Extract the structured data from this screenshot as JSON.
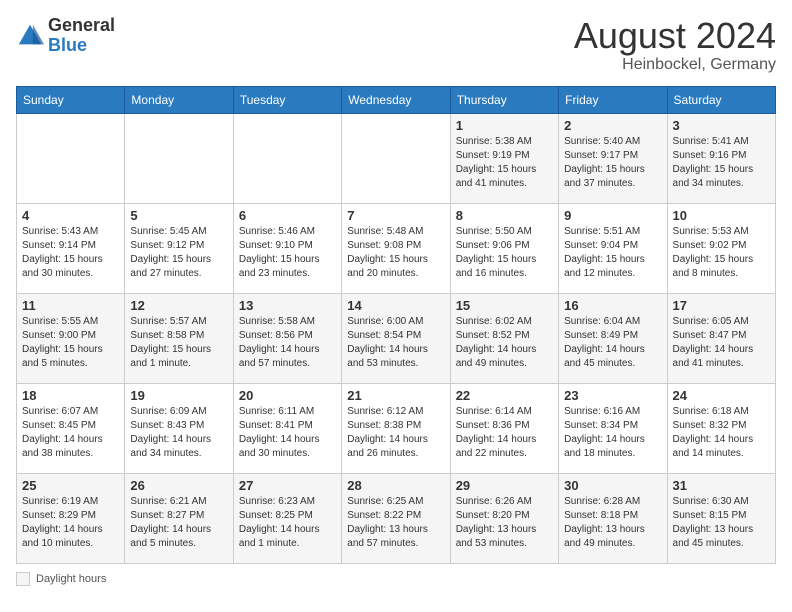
{
  "header": {
    "logo_general": "General",
    "logo_blue": "Blue",
    "month": "August 2024",
    "location": "Heinbockel, Germany"
  },
  "days_of_week": [
    "Sunday",
    "Monday",
    "Tuesday",
    "Wednesday",
    "Thursday",
    "Friday",
    "Saturday"
  ],
  "weeks": [
    [
      {
        "day": "",
        "info": ""
      },
      {
        "day": "",
        "info": ""
      },
      {
        "day": "",
        "info": ""
      },
      {
        "day": "",
        "info": ""
      },
      {
        "day": "1",
        "info": "Sunrise: 5:38 AM\nSunset: 9:19 PM\nDaylight: 15 hours\nand 41 minutes."
      },
      {
        "day": "2",
        "info": "Sunrise: 5:40 AM\nSunset: 9:17 PM\nDaylight: 15 hours\nand 37 minutes."
      },
      {
        "day": "3",
        "info": "Sunrise: 5:41 AM\nSunset: 9:16 PM\nDaylight: 15 hours\nand 34 minutes."
      }
    ],
    [
      {
        "day": "4",
        "info": "Sunrise: 5:43 AM\nSunset: 9:14 PM\nDaylight: 15 hours\nand 30 minutes."
      },
      {
        "day": "5",
        "info": "Sunrise: 5:45 AM\nSunset: 9:12 PM\nDaylight: 15 hours\nand 27 minutes."
      },
      {
        "day": "6",
        "info": "Sunrise: 5:46 AM\nSunset: 9:10 PM\nDaylight: 15 hours\nand 23 minutes."
      },
      {
        "day": "7",
        "info": "Sunrise: 5:48 AM\nSunset: 9:08 PM\nDaylight: 15 hours\nand 20 minutes."
      },
      {
        "day": "8",
        "info": "Sunrise: 5:50 AM\nSunset: 9:06 PM\nDaylight: 15 hours\nand 16 minutes."
      },
      {
        "day": "9",
        "info": "Sunrise: 5:51 AM\nSunset: 9:04 PM\nDaylight: 15 hours\nand 12 minutes."
      },
      {
        "day": "10",
        "info": "Sunrise: 5:53 AM\nSunset: 9:02 PM\nDaylight: 15 hours\nand 8 minutes."
      }
    ],
    [
      {
        "day": "11",
        "info": "Sunrise: 5:55 AM\nSunset: 9:00 PM\nDaylight: 15 hours\nand 5 minutes."
      },
      {
        "day": "12",
        "info": "Sunrise: 5:57 AM\nSunset: 8:58 PM\nDaylight: 15 hours\nand 1 minute."
      },
      {
        "day": "13",
        "info": "Sunrise: 5:58 AM\nSunset: 8:56 PM\nDaylight: 14 hours\nand 57 minutes."
      },
      {
        "day": "14",
        "info": "Sunrise: 6:00 AM\nSunset: 8:54 PM\nDaylight: 14 hours\nand 53 minutes."
      },
      {
        "day": "15",
        "info": "Sunrise: 6:02 AM\nSunset: 8:52 PM\nDaylight: 14 hours\nand 49 minutes."
      },
      {
        "day": "16",
        "info": "Sunrise: 6:04 AM\nSunset: 8:49 PM\nDaylight: 14 hours\nand 45 minutes."
      },
      {
        "day": "17",
        "info": "Sunrise: 6:05 AM\nSunset: 8:47 PM\nDaylight: 14 hours\nand 41 minutes."
      }
    ],
    [
      {
        "day": "18",
        "info": "Sunrise: 6:07 AM\nSunset: 8:45 PM\nDaylight: 14 hours\nand 38 minutes."
      },
      {
        "day": "19",
        "info": "Sunrise: 6:09 AM\nSunset: 8:43 PM\nDaylight: 14 hours\nand 34 minutes."
      },
      {
        "day": "20",
        "info": "Sunrise: 6:11 AM\nSunset: 8:41 PM\nDaylight: 14 hours\nand 30 minutes."
      },
      {
        "day": "21",
        "info": "Sunrise: 6:12 AM\nSunset: 8:38 PM\nDaylight: 14 hours\nand 26 minutes."
      },
      {
        "day": "22",
        "info": "Sunrise: 6:14 AM\nSunset: 8:36 PM\nDaylight: 14 hours\nand 22 minutes."
      },
      {
        "day": "23",
        "info": "Sunrise: 6:16 AM\nSunset: 8:34 PM\nDaylight: 14 hours\nand 18 minutes."
      },
      {
        "day": "24",
        "info": "Sunrise: 6:18 AM\nSunset: 8:32 PM\nDaylight: 14 hours\nand 14 minutes."
      }
    ],
    [
      {
        "day": "25",
        "info": "Sunrise: 6:19 AM\nSunset: 8:29 PM\nDaylight: 14 hours\nand 10 minutes."
      },
      {
        "day": "26",
        "info": "Sunrise: 6:21 AM\nSunset: 8:27 PM\nDaylight: 14 hours\nand 5 minutes."
      },
      {
        "day": "27",
        "info": "Sunrise: 6:23 AM\nSunset: 8:25 PM\nDaylight: 14 hours\nand 1 minute."
      },
      {
        "day": "28",
        "info": "Sunrise: 6:25 AM\nSunset: 8:22 PM\nDaylight: 13 hours\nand 57 minutes."
      },
      {
        "day": "29",
        "info": "Sunrise: 6:26 AM\nSunset: 8:20 PM\nDaylight: 13 hours\nand 53 minutes."
      },
      {
        "day": "30",
        "info": "Sunrise: 6:28 AM\nSunset: 8:18 PM\nDaylight: 13 hours\nand 49 minutes."
      },
      {
        "day": "31",
        "info": "Sunrise: 6:30 AM\nSunset: 8:15 PM\nDaylight: 13 hours\nand 45 minutes."
      }
    ]
  ],
  "footer": {
    "daylight_label": "Daylight hours"
  }
}
